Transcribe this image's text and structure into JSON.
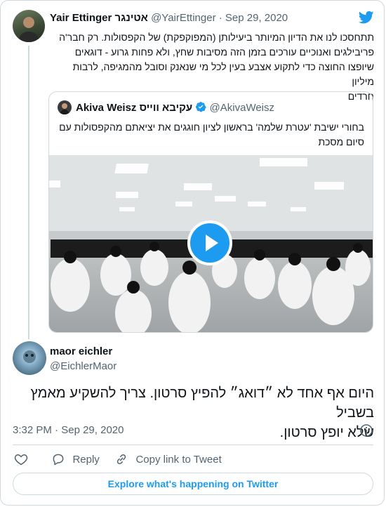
{
  "colors": {
    "accent": "#1d9bf0",
    "text": "#0f1419",
    "muted": "#536471",
    "border": "#cfd9de"
  },
  "tweet1": {
    "name": "Yair Ettinger אטינגר",
    "handle": "@YairEttinger",
    "sep": "·",
    "date": "Sep 29, 2020",
    "text_lines": [
      "תתחסכו לנו את הדיון המיותר ביעילותן (המפוקפקת) של הקפסולות. רק חבר'ה",
      "פריבילגים ואנוכיים עורכים בזמן הזה מסיבות שחץ, ולא פחות גרוע - דוגאים",
      "שיופצו החוצה כדי לתקוע אצבע בעין לכל מי שנאנק וסובל מהמגיפה, לרבות מיליון",
      "חרדים"
    ]
  },
  "quote": {
    "name": "Akiva Weisz עקיבא ווייס",
    "handle": "@AkivaWeisz",
    "text_lines": [
      "בחורי ישיבת 'עטרת שלמה' בראשון לציון חוגגים את יציאתם מהקפסולות עם",
      "סיום מסכת"
    ]
  },
  "tweet2": {
    "name": "maor eichler",
    "handle": "@EichlerMaor",
    "text_lines": [
      "היום אף אחד לא ״דואג״ להפיץ סרטון. צריך להשקיע מאמץ בשביל",
      "שלא יופץ סרטון."
    ],
    "time": "3:32 PM",
    "sep": "·",
    "date": "Sep 29, 2020"
  },
  "actions": {
    "reply": "Reply",
    "copy_link": "Copy link to Tweet"
  },
  "explore_button": "Explore what's happening on Twitter"
}
